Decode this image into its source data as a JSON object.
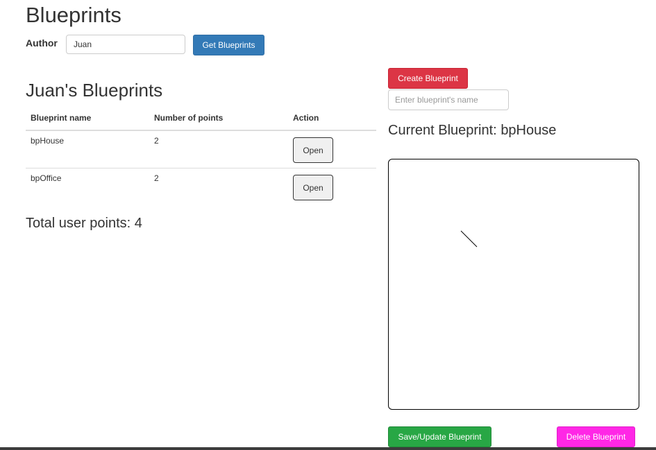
{
  "page": {
    "title": "Blueprints"
  },
  "search": {
    "author_label": "Author",
    "author_value": "Juan",
    "get_button": "Get Blueprints"
  },
  "list": {
    "title": "Juan's Blueprints",
    "headers": {
      "name": "Blueprint name",
      "points": "Number of points",
      "action": "Action"
    },
    "rows": [
      {
        "name": "bpHouse",
        "points": "2",
        "action": "Open"
      },
      {
        "name": "bpOffice",
        "points": "2",
        "action": "Open"
      }
    ],
    "total_label": "Total user points:",
    "total_value": "4"
  },
  "editor": {
    "create_button": "Create Blueprint",
    "name_placeholder": "Enter blueprint's name",
    "current_label": "Current Blueprint:",
    "current_name": "bpHouse",
    "save_button": "Save/Update Blueprint",
    "delete_button": "Delete Blueprint"
  },
  "colors": {
    "get_button": "#337ab7",
    "create_button": "#dc3545",
    "save_button": "#28a745",
    "delete_button": "#ff27e6"
  }
}
